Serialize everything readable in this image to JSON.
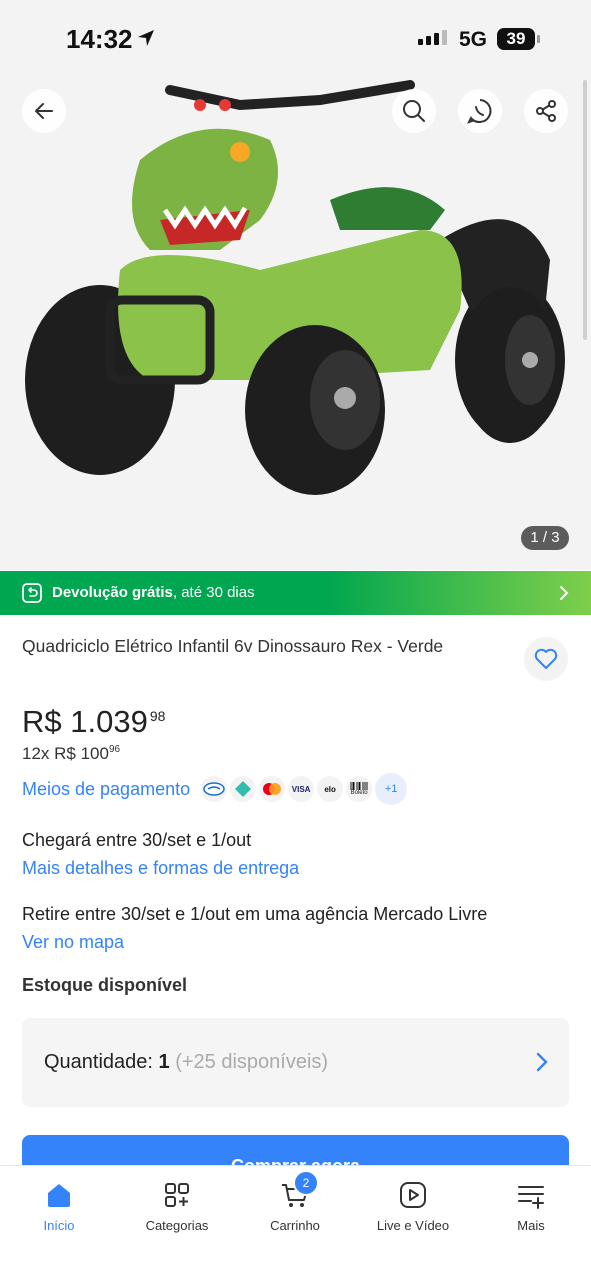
{
  "status_bar": {
    "time": "14:32",
    "network": "5G",
    "battery": "39"
  },
  "gallery": {
    "counter": "1 / 3"
  },
  "promo": {
    "bold": "Devolução grátis",
    "text": ", até 30 dias"
  },
  "product": {
    "title": "Quadriciclo Elétrico Infantil 6v Dinossauro Rex - Verde",
    "price_main": "R$ 1.039",
    "price_cents": "98",
    "installments_text": "12x R$ 100",
    "installments_cents": "96"
  },
  "payment": {
    "link": "Meios de pagamento",
    "icons": [
      "mercado-pago",
      "pix",
      "mastercard",
      "VISA",
      "elo",
      "Boleto"
    ],
    "more": "+1"
  },
  "delivery": {
    "arrive": "Chegará entre 30/set e 1/out",
    "details_link": "Mais detalhes e formas de entrega",
    "pickup": "Retire entre 30/set e 1/out em uma agência Mercado Livre",
    "map_link": "Ver no mapa"
  },
  "stock": "Estoque disponível",
  "quantity": {
    "label": "Quantidade: ",
    "value": "1",
    "available": "(+25 disponíveis)"
  },
  "buy_button": "Comprar agora",
  "tabbar": {
    "tabs": [
      {
        "label": "Início",
        "icon": "home-icon"
      },
      {
        "label": "Categorias",
        "icon": "categories-icon"
      },
      {
        "label": "Carrinho",
        "icon": "cart-icon"
      },
      {
        "label": "Live e Vídeo",
        "icon": "play-icon"
      },
      {
        "label": "Mais",
        "icon": "menu-plus-icon"
      }
    ],
    "cart_count": "2"
  },
  "colors": {
    "accent": "#3483fa",
    "promo_green": "#00a650"
  }
}
